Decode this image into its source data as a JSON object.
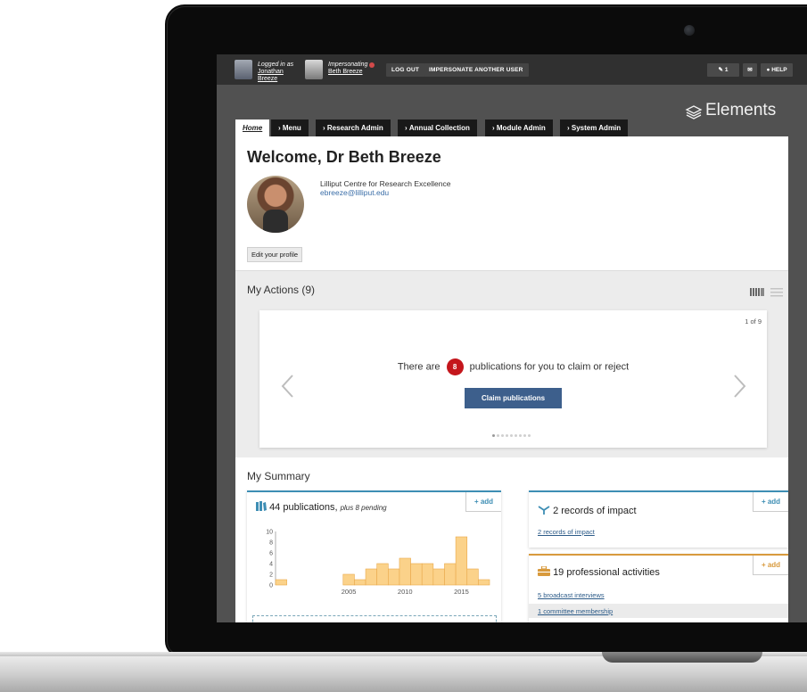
{
  "topbar": {
    "logged_in_label": "Logged in as",
    "logged_in_first": "Jonathan",
    "logged_in_last": "Breeze",
    "impersonating_label": "Impersonating",
    "impersonating_name": "Beth Breeze",
    "logout_label": "LOG OUT",
    "impersonate_label": "IMPERSONATE ANOTHER USER",
    "notifications_count": "1",
    "help_label": "HELP"
  },
  "brand": {
    "name": "Elements"
  },
  "tabs": [
    {
      "label": "Home"
    },
    {
      "label": "Menu"
    },
    {
      "label": "Research Admin"
    },
    {
      "label": "Annual Collection"
    },
    {
      "label": "Module Admin"
    },
    {
      "label": "System Admin"
    }
  ],
  "profile": {
    "welcome": "Welcome, Dr Beth Breeze",
    "affiliation": "Lilliput Centre for Research Excellence",
    "email": "ebreeze@lilliput.edu",
    "edit_label": "Edit your profile"
  },
  "actions": {
    "title": "My Actions (9)",
    "pager": "1 of 9",
    "claim_prefix": "There are",
    "claim_count": "8",
    "claim_suffix": "publications for you to claim or reject",
    "claim_button": "Claim publications",
    "dots": 9
  },
  "summary": {
    "title": "My Summary",
    "add_label": "+ add",
    "publications": {
      "title": "44 publications,",
      "pending": "plus 8 pending"
    },
    "impact": {
      "title": "2 records of impact",
      "link": "2 records of impact"
    },
    "professional": {
      "title": "19 professional activities",
      "link1": "5 broadcast interviews",
      "link2": "1 committee membership"
    }
  },
  "colors": {
    "accent_blue": "#3d5f8c",
    "badge_red": "#c4161c",
    "bar_fill": "#fbd28a",
    "bar_stroke": "#e9a84a",
    "pub_icon": "#3e8eb4",
    "prof_icon": "#d89a3d"
  },
  "chart_data": {
    "type": "bar",
    "x": [
      1999,
      2000,
      2001,
      2002,
      2003,
      2004,
      2005,
      2006,
      2007,
      2008,
      2009,
      2010,
      2011,
      2012,
      2013,
      2014,
      2015,
      2016,
      2017
    ],
    "values": [
      1,
      0,
      0,
      0,
      0,
      0,
      2,
      1,
      3,
      4,
      3,
      5,
      4,
      4,
      3,
      4,
      9,
      3,
      1
    ],
    "ylim": [
      0,
      10
    ],
    "yticks": [
      0,
      2,
      4,
      6,
      8,
      10
    ],
    "xticks": [
      2005,
      2010,
      2015
    ],
    "grid": false
  }
}
